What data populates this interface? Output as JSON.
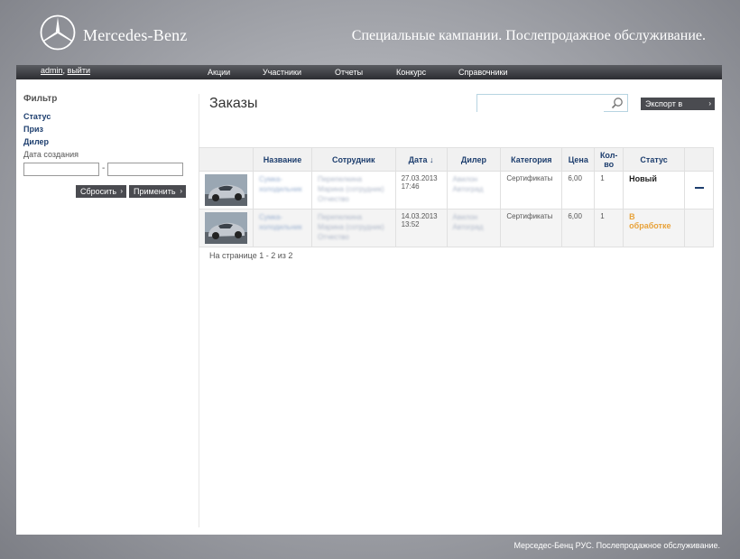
{
  "header": {
    "brand": "Mercedes-Benz",
    "tagline": "Специальные кампании. Послепродажное обслуживание."
  },
  "topnav": {
    "user": "admin",
    "separator": ",",
    "logout": "выйти",
    "menu": [
      "Акции",
      "Участники",
      "Отчеты",
      "Конкурс",
      "Справочники"
    ]
  },
  "sidebar": {
    "title": "Фильтр",
    "links": [
      "Статус",
      "Приз",
      "Дилер"
    ],
    "date_label": "Дата создания",
    "date_from": "",
    "date_to": "",
    "date_sep": "-",
    "reset_label": "Сбросить",
    "apply_label": "Применить"
  },
  "main": {
    "title": "Заказы",
    "search_placeholder": "",
    "export_label": "Экспорт в Excel"
  },
  "table": {
    "headers": [
      "Название",
      "Сотрудник",
      "Дата ↓",
      "Дилер",
      "Категория",
      "Цена",
      "Кол-во",
      "Статус"
    ],
    "rows": [
      {
        "name": "Сумка-холодильник",
        "employee": "Перепелкина Марина (сотрудник) Отчество",
        "date": "27.03.2013",
        "time": "17:46",
        "dealer": "Авилон Автоград",
        "category": "Сертификаты",
        "price": "6,00",
        "qty": "1",
        "status": "Новый"
      },
      {
        "name": "Сумка-холодильник",
        "employee": "Перепелкина Марина (сотрудник) Отчество",
        "date": "14.03.2013",
        "time": "13:52",
        "dealer": "Авилон Автоград",
        "category": "Сертификаты",
        "price": "6,00",
        "qty": "1",
        "status": "В обработке"
      }
    ]
  },
  "pager": "На странице 1 - 2 из 2",
  "footer": "Мерседес-Бенц РУС. Послепродажное обслуживание.",
  "colors": {
    "nav_bar": "#2c2d31",
    "link_blue": "#1d3e6e",
    "status_processing": "#e8a23a",
    "button_dark": "#4a4b50"
  }
}
